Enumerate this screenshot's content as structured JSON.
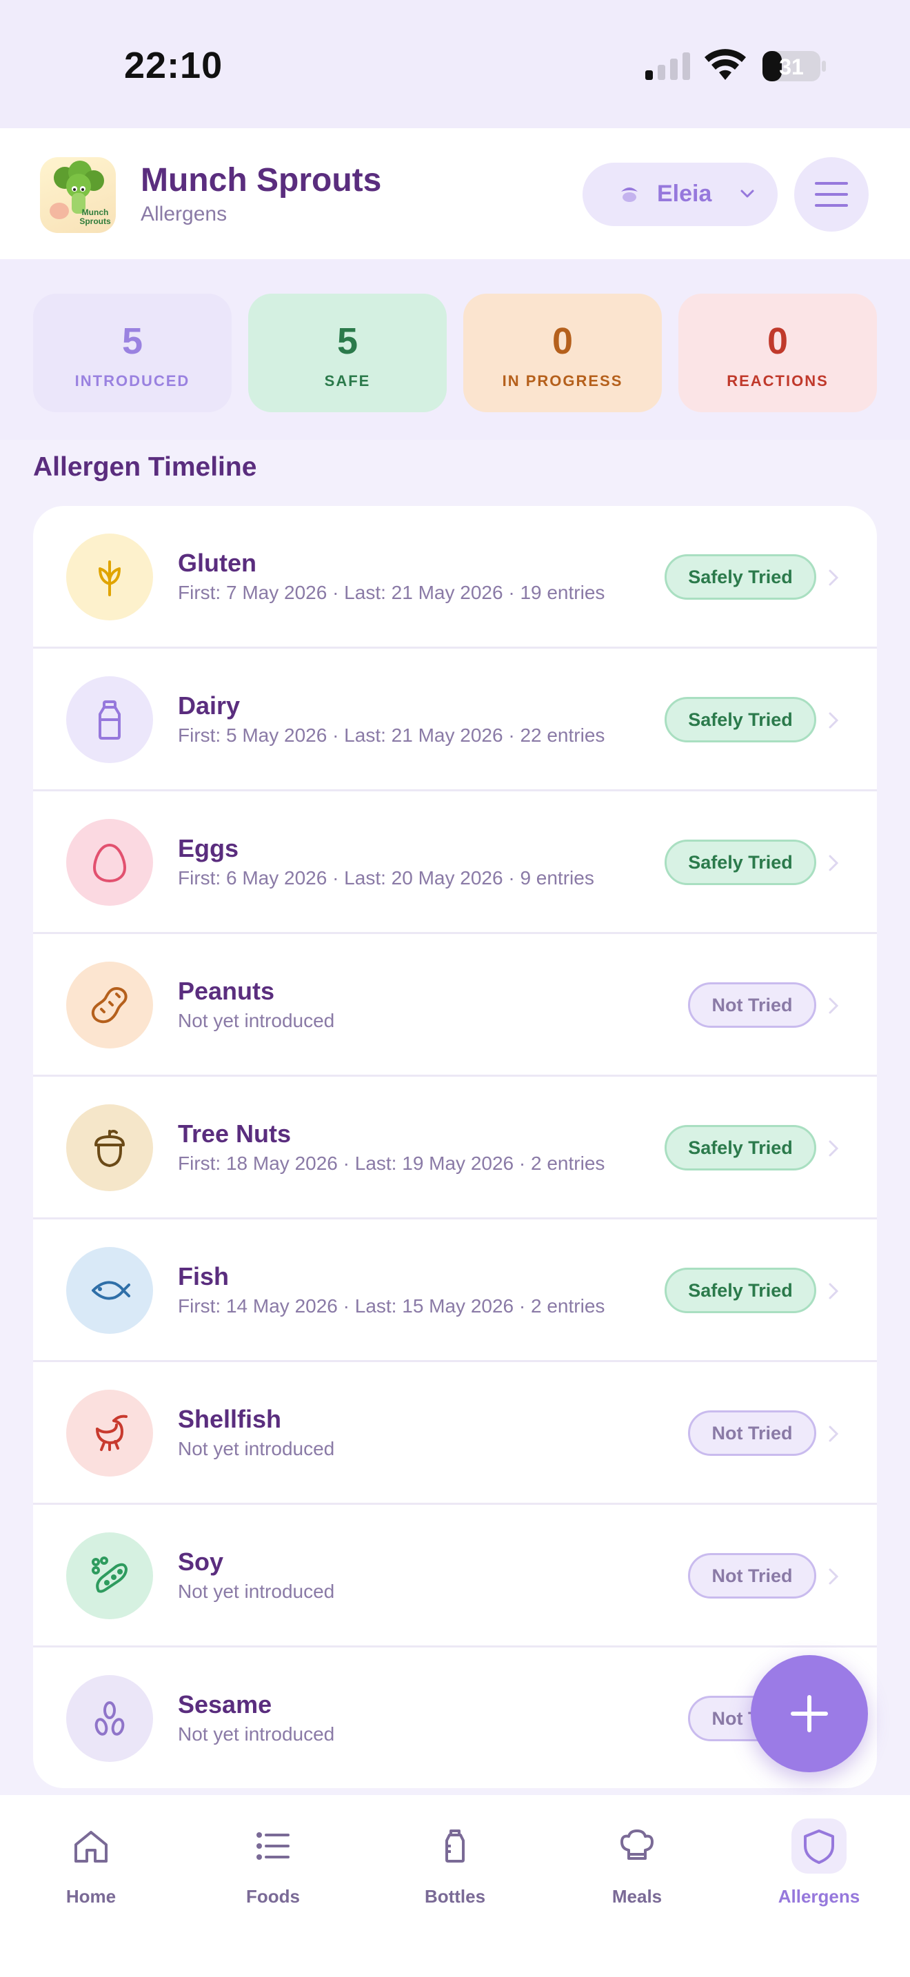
{
  "status_bar": {
    "time": "22:10",
    "battery": "31"
  },
  "header": {
    "app_title": "Munch Sprouts",
    "app_subtitle": "Allergens",
    "app_icon_text": "Munch Sprouts",
    "child_name": "Eleia"
  },
  "stats": [
    {
      "value": "5",
      "label": "INTRODUCED"
    },
    {
      "value": "5",
      "label": "SAFE"
    },
    {
      "value": "0",
      "label": "IN PROGRESS"
    },
    {
      "value": "0",
      "label": "REACTIONS"
    }
  ],
  "section_title": "Allergen Timeline",
  "allergens": [
    {
      "name": "Gluten",
      "meta": "First: 7 May 2026 · Last: 21 May 2026 · 19 entries",
      "status": "Safely Tried",
      "icon": "wheat-icon",
      "color": "#f5b400",
      "bg": "#fdf1cc"
    },
    {
      "name": "Dairy",
      "meta": "First: 5 May 2026 · Last: 21 May 2026 · 22 entries",
      "status": "Safely Tried",
      "icon": "milk-bottle-icon",
      "color": "#9678dc",
      "bg": "#ece7fb"
    },
    {
      "name": "Eggs",
      "meta": "First: 6 May 2026 · Last: 20 May 2026 · 9 entries",
      "status": "Safely Tried",
      "icon": "egg-icon",
      "color": "#e2516f",
      "bg": "#fbd9e1"
    },
    {
      "name": "Peanuts",
      "meta": "Not yet introduced",
      "status": "Not Tried",
      "icon": "peanut-icon",
      "color": "#b5601c",
      "bg": "#fce5d0"
    },
    {
      "name": "Tree Nuts",
      "meta": "First: 18 May 2026 · Last: 19 May 2026 · 2 entries",
      "status": "Safely Tried",
      "icon": "acorn-icon",
      "color": "#7a5a1c",
      "bg": "#f5e6c9"
    },
    {
      "name": "Fish",
      "meta": "First: 14 May 2026 · Last: 15 May 2026 · 2 entries",
      "status": "Safely Tried",
      "icon": "fish-icon",
      "color": "#2f6fa8",
      "bg": "#d9e9f7"
    },
    {
      "name": "Shellfish",
      "meta": "Not yet introduced",
      "status": "Not Tried",
      "icon": "shrimp-icon",
      "color": "#c83a2e",
      "bg": "#fbe0de"
    },
    {
      "name": "Soy",
      "meta": "Not yet introduced",
      "status": "Not Tried",
      "icon": "soybean-icon",
      "color": "#2e9b5e",
      "bg": "#d6f1e1"
    },
    {
      "name": "Sesame",
      "meta": "Not yet introduced",
      "status": "Not Tried",
      "icon": "sesame-icon",
      "color": "#8f74c9",
      "bg": "#ebe6f8"
    }
  ],
  "tabs": [
    {
      "label": "Home",
      "icon": "home-icon"
    },
    {
      "label": "Foods",
      "icon": "list-icon"
    },
    {
      "label": "Bottles",
      "icon": "bottle-icon"
    },
    {
      "label": "Meals",
      "icon": "chef-hat-icon"
    },
    {
      "label": "Allergens",
      "icon": "shield-icon",
      "active": true
    }
  ],
  "colors": {
    "accent": "#9678dc",
    "title": "#5a2d7e",
    "safe": "#2b7a4b",
    "progress": "#b5601c",
    "reactions": "#c0392b"
  }
}
